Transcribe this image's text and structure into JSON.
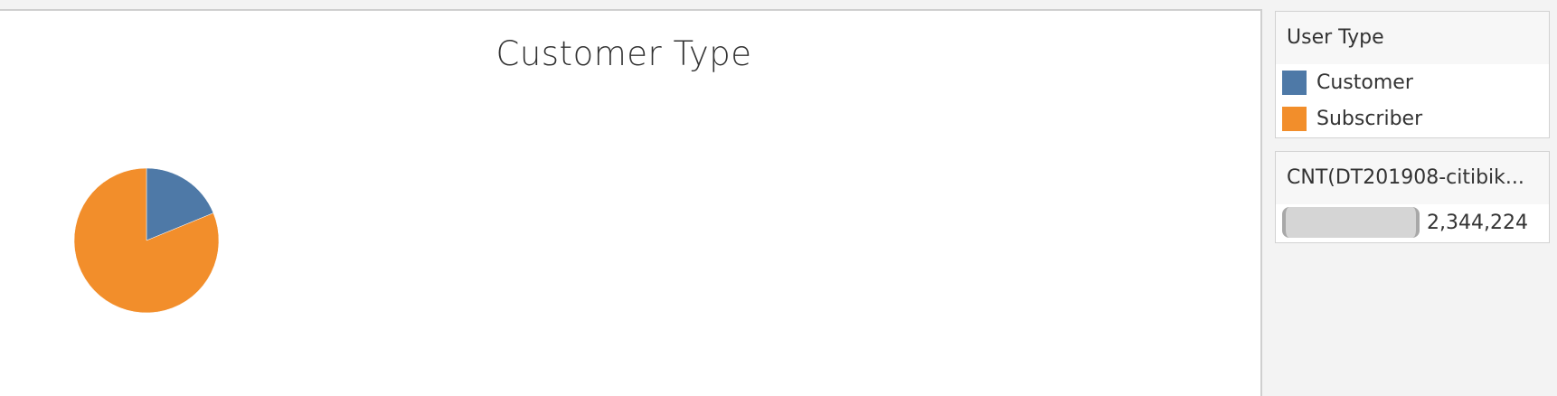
{
  "chart_data": {
    "type": "pie",
    "title": "Customer Type",
    "categories": [
      "Customer",
      "Subscriber"
    ],
    "values": [
      0.188,
      0.812
    ],
    "colors": [
      "#4e79a7",
      "#f28e2b"
    ]
  },
  "legend": {
    "title": "User Type",
    "items": [
      {
        "label": "Customer",
        "color": "#4e79a7"
      },
      {
        "label": "Subscriber",
        "color": "#f28e2b"
      }
    ]
  },
  "size_legend": {
    "title": "CNT(DT201908-citibik...",
    "value": "2,344,224"
  }
}
